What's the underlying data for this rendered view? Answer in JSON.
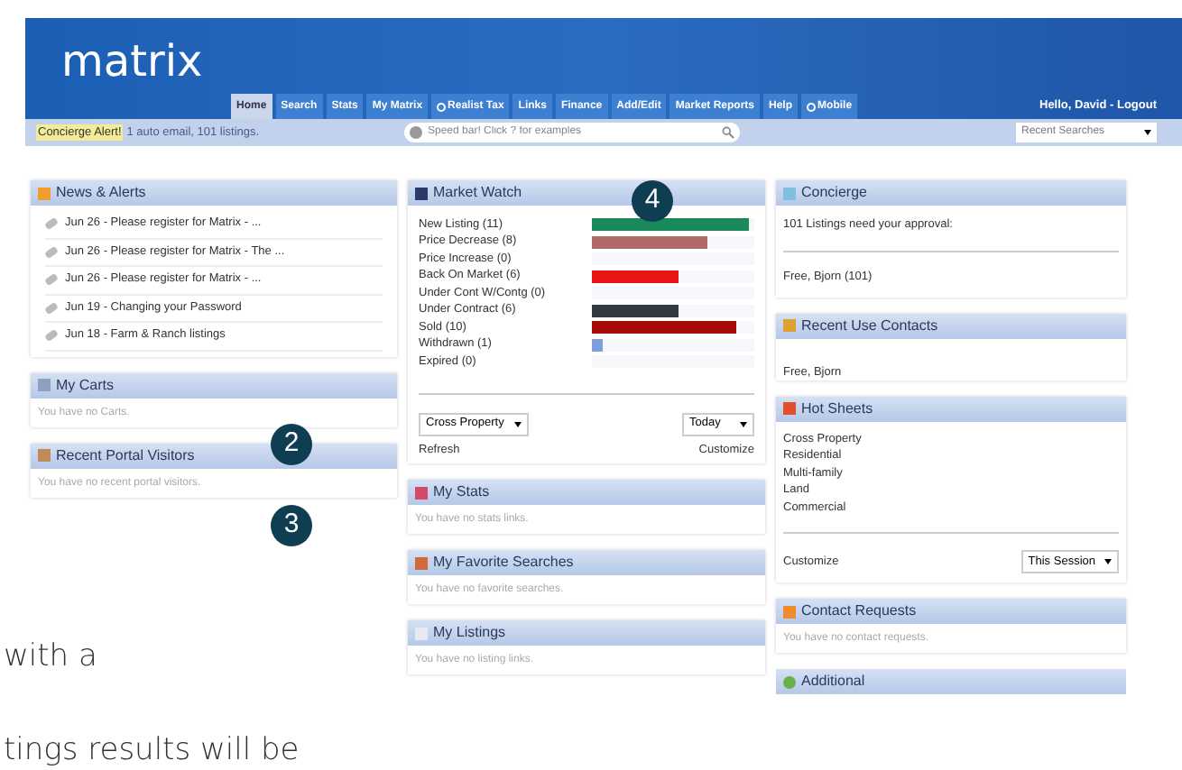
{
  "header": {
    "logo": "matrix",
    "greeting": "Hello, David - Logout",
    "tabs": [
      {
        "label": "Home",
        "selected": true,
        "has_icon": false
      },
      {
        "label": "Search",
        "selected": false,
        "has_icon": false
      },
      {
        "label": "Stats",
        "selected": false,
        "has_icon": false
      },
      {
        "label": "My Matrix",
        "selected": false,
        "has_icon": false
      },
      {
        "label": "Realist Tax",
        "selected": false,
        "has_icon": true
      },
      {
        "label": "Links",
        "selected": false,
        "has_icon": false
      },
      {
        "label": "Finance",
        "selected": false,
        "has_icon": false
      },
      {
        "label": "Add/Edit",
        "selected": false,
        "has_icon": false
      },
      {
        "label": "Market Reports",
        "selected": false,
        "has_icon": false
      },
      {
        "label": "Help",
        "selected": false,
        "has_icon": false
      },
      {
        "label": "Mobile",
        "selected": false,
        "has_icon": true
      }
    ]
  },
  "subbar": {
    "alert_badge": "Concierge Alert!",
    "alert_text": "1 auto email, 101 listings.",
    "speed_bar": {
      "placeholder": "Speed bar! Click ? for examples"
    },
    "recent_searches": "Recent Searches"
  },
  "columns": [
    [
      {
        "kind": "links",
        "title": "News & Alerts",
        "items": [
          "Jun 26 - Please register for Matrix - ...",
          "Jun 26 - Please register for Matrix - The ...",
          "Jun 26 - Please register for Matrix - ...",
          "Jun 19 - Changing your Password",
          "Jun 18 - Farm & Ranch listings"
        ]
      },
      {
        "kind": "note",
        "title": "My Carts",
        "text": "You have no Carts."
      },
      {
        "kind": "note",
        "title": "Recent Portal Visitors",
        "text": "You have no recent portal visitors."
      }
    ],
    [
      {
        "kind": "market_watch",
        "title": "Market Watch",
        "rows": [
          {
            "label": "New Listing (11)",
            "level": 0.97,
            "color": "#1a8a5a"
          },
          {
            "label": "Price Decrease (8)",
            "level": 0.71,
            "color": "#b06a6a"
          },
          {
            "label": "Price Increase (0)"
          },
          {
            "label": "Back On Market (6)",
            "level": 0.53,
            "color": "#e81515"
          },
          {
            "label": "Under Cont W/Contg (0)"
          },
          {
            "label": "Under Contract (6)",
            "level": 0.53,
            "color": "#333a40"
          },
          {
            "label": "Sold (10)",
            "level": 0.89,
            "color": "#a80808"
          },
          {
            "label": "Withdrawn (1)",
            "level": 0.07,
            "color": "#7f9fdb"
          },
          {
            "label": "Expired (0)"
          }
        ],
        "select_left": "Cross Property",
        "select_right": "Today",
        "link_left": "Refresh",
        "link_right": "Customize"
      },
      {
        "kind": "note",
        "title": "My Stats",
        "text": "You have no stats links."
      },
      {
        "kind": "note",
        "title": "My Favorite Searches",
        "text": "You have no favorite searches."
      },
      {
        "kind": "note",
        "title": "My Listings",
        "text": "You have no listing links."
      }
    ],
    [
      {
        "kind": "concierge",
        "title": "Concierge",
        "text": "101 Listings need your approval:",
        "link": "Free, Bjorn (101)"
      },
      {
        "kind": "plain",
        "title": "Recent Use Contacts",
        "text": "Free, Bjorn"
      },
      {
        "kind": "hot_sheets",
        "title": "Hot Sheets",
        "items": [
          "Cross Property",
          "Residential",
          "Multi-family",
          "Land",
          "Commercial"
        ],
        "link": "Customize",
        "select": "This Session"
      },
      {
        "kind": "note",
        "title": "Contact Requests",
        "text": "You have no contact requests."
      },
      {
        "kind": "header_only",
        "title": "Additional"
      }
    ]
  ],
  "callouts": [
    "2",
    "3",
    "4"
  ],
  "slide_text": [
    "with a",
    "tings results will be"
  ]
}
